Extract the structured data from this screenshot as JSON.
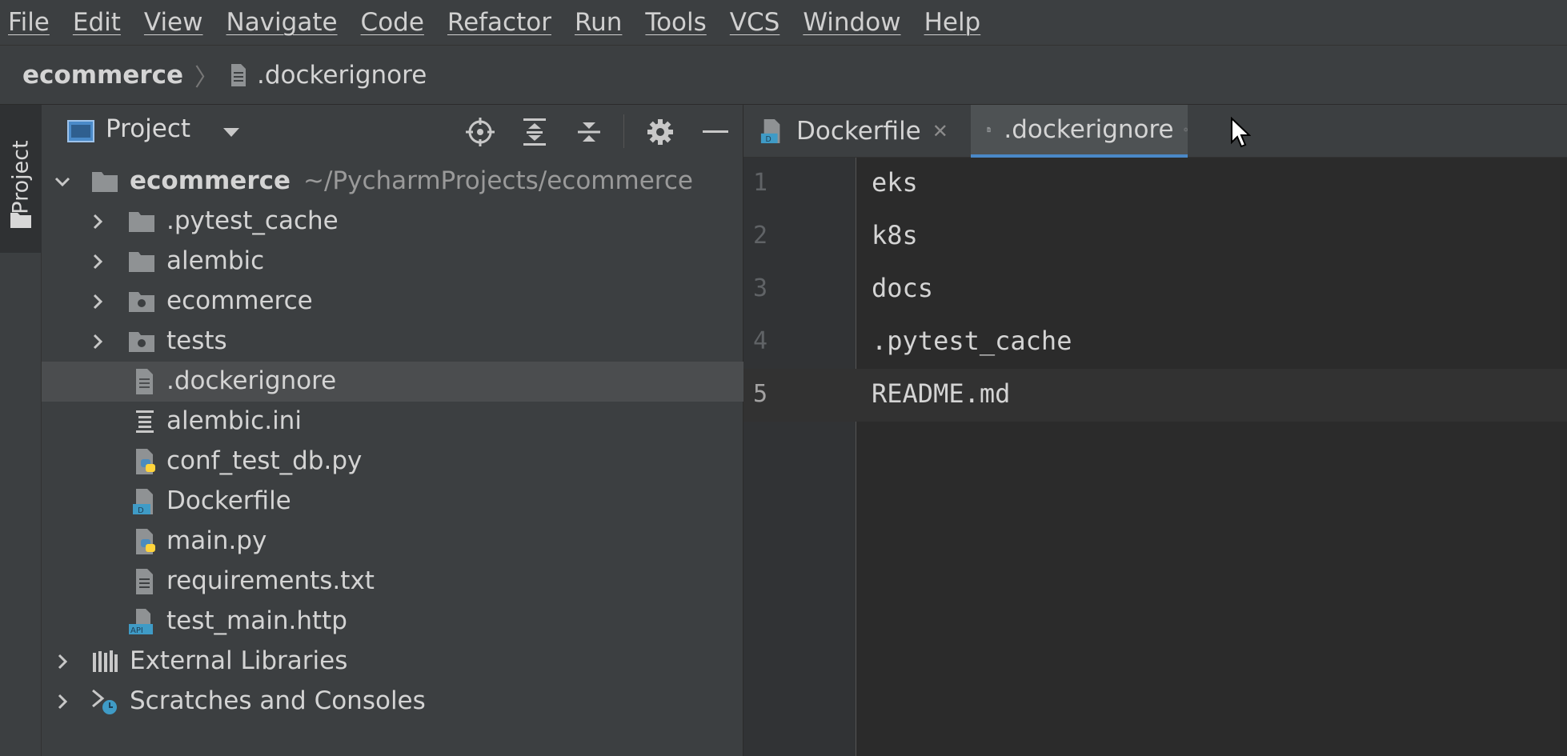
{
  "menu": [
    "File",
    "Edit",
    "View",
    "Navigate",
    "Code",
    "Refactor",
    "Run",
    "Tools",
    "VCS",
    "Window",
    "Help"
  ],
  "breadcrumb": {
    "project": "ecommerce",
    "file": ".dockerignore"
  },
  "toolstrip": {
    "label": "Project"
  },
  "project_panel": {
    "title": "Project",
    "root": {
      "name": "ecommerce",
      "path": "~/PycharmProjects/ecommerce"
    },
    "items": [
      {
        "label": ".pytest_cache",
        "icon": "folder-icon"
      },
      {
        "label": "alembic",
        "icon": "folder-icon"
      },
      {
        "label": "ecommerce",
        "icon": "package-folder-icon"
      },
      {
        "label": "tests",
        "icon": "package-folder-icon"
      },
      {
        "label": ".dockerignore",
        "icon": "text-file-icon"
      },
      {
        "label": "alembic.ini",
        "icon": "ini-file-icon"
      },
      {
        "label": "conf_test_db.py",
        "icon": "python-file-icon"
      },
      {
        "label": "Dockerfile",
        "icon": "docker-file-icon"
      },
      {
        "label": "main.py",
        "icon": "python-file-icon"
      },
      {
        "label": "requirements.txt",
        "icon": "text-file-icon"
      },
      {
        "label": "test_main.http",
        "icon": "http-file-icon"
      }
    ],
    "external_libraries": "External Libraries",
    "scratches": "Scratches and Consoles",
    "selected": ".dockerignore"
  },
  "editor": {
    "tabs": [
      {
        "label": "Dockerfile",
        "active": false
      },
      {
        "label": ".dockerignore",
        "active": true
      }
    ],
    "lines": [
      {
        "num": "1",
        "text": "eks"
      },
      {
        "num": "2",
        "text": "k8s"
      },
      {
        "num": "3",
        "text": "docs"
      },
      {
        "num": "4",
        "text": ".pytest_cache"
      },
      {
        "num": "5",
        "text": "README.md"
      }
    ],
    "current_line": 5
  },
  "colors": {
    "accent": "#4a88c7",
    "folder": "#8f9294",
    "python_blue": "#4b8bbe",
    "python_yellow": "#ffd43b",
    "docker_blue": "#3f9bc6"
  }
}
